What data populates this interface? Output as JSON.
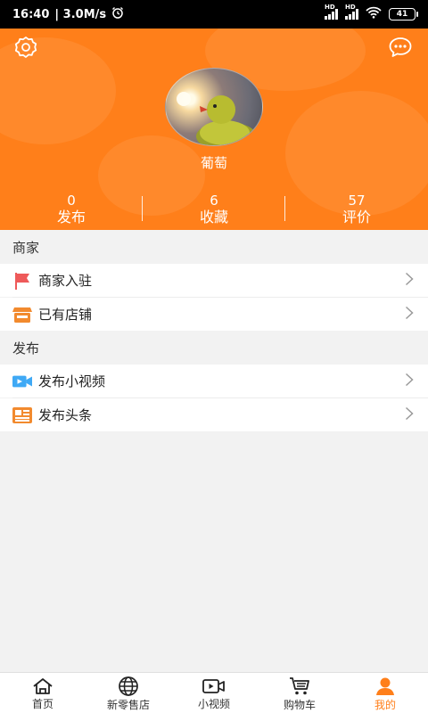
{
  "status_bar": {
    "time": "16:40",
    "speed": "| 3.0M/s",
    "battery": "41",
    "network_tag": "HD"
  },
  "header": {
    "nickname": "葡萄",
    "settings_icon": "gear-icon",
    "message_icon": "chat-bubble-icon",
    "bg_color": "#ff7f1a",
    "stats": [
      {
        "value": "0",
        "label": "发布"
      },
      {
        "value": "6",
        "label": "收藏"
      },
      {
        "value": "57",
        "label": "评价"
      }
    ]
  },
  "sections": [
    {
      "title": "商家",
      "items": [
        {
          "label": "商家入驻",
          "icon": "flag-icon"
        },
        {
          "label": "已有店铺",
          "icon": "shop-icon"
        }
      ]
    },
    {
      "title": "发布",
      "items": [
        {
          "label": "发布小视频",
          "icon": "video-camera-icon"
        },
        {
          "label": "发布头条",
          "icon": "news-icon"
        }
      ]
    }
  ],
  "bottom_nav": [
    {
      "label": "首页",
      "icon": "home-icon",
      "active": false
    },
    {
      "label": "新零售店",
      "icon": "globe-icon",
      "active": false
    },
    {
      "label": "小视频",
      "icon": "video-icon",
      "active": false
    },
    {
      "label": "购物车",
      "icon": "cart-icon",
      "active": false
    },
    {
      "label": "我的",
      "icon": "user-icon",
      "active": true
    }
  ],
  "colors": {
    "accent": "#ff7f1a",
    "flag": "#ee5a5a",
    "video": "#3fa9f5"
  }
}
